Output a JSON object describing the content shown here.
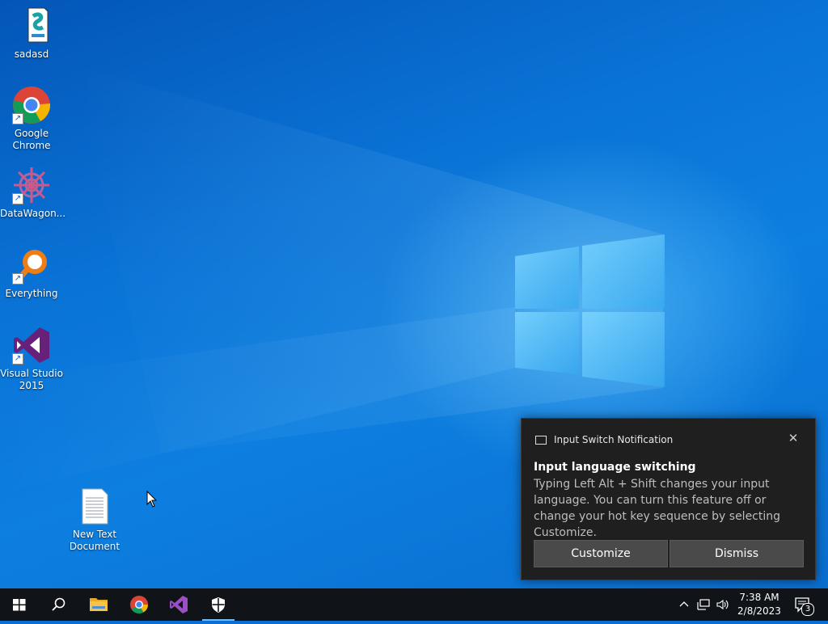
{
  "desktop": {
    "icons": [
      {
        "label": "sadasd",
        "icon": "setup-file-icon"
      },
      {
        "label": "Google Chrome",
        "icon": "chrome-icon"
      },
      {
        "label": "DataWagon...",
        "icon": "datawagon-icon"
      },
      {
        "label": "Everything",
        "icon": "everything-search-icon"
      },
      {
        "label": "Visual Studio 2015",
        "icon": "visual-studio-icon"
      },
      {
        "label": "New Text Document",
        "icon": "text-file-icon"
      }
    ]
  },
  "notification": {
    "app_name": "Input Switch Notification",
    "title": "Input language switching",
    "body": "Typing Left Alt + Shift changes your input language. You can turn this feature off or change your hot key sequence by selecting Customize.",
    "customize_label": "Customize",
    "dismiss_label": "Dismiss",
    "close_icon": "close-icon"
  },
  "taskbar": {
    "items": [
      {
        "name": "start",
        "icon": "windows-logo-icon"
      },
      {
        "name": "search",
        "icon": "search-icon"
      },
      {
        "name": "file-explorer",
        "icon": "folder-icon"
      },
      {
        "name": "chrome",
        "icon": "chrome-icon"
      },
      {
        "name": "visual-studio",
        "icon": "visual-studio-icon"
      },
      {
        "name": "windows-security",
        "icon": "shield-icon",
        "active": true
      }
    ],
    "tray": {
      "time": "7:38 AM",
      "date": "2/8/2023",
      "notification_count": "3"
    }
  },
  "colors": {
    "wallpaper_blue": "#0a6fd4",
    "taskbar_bg": "#101318",
    "toast_bg": "#1f1f1f",
    "accent": "#76b9ed"
  }
}
